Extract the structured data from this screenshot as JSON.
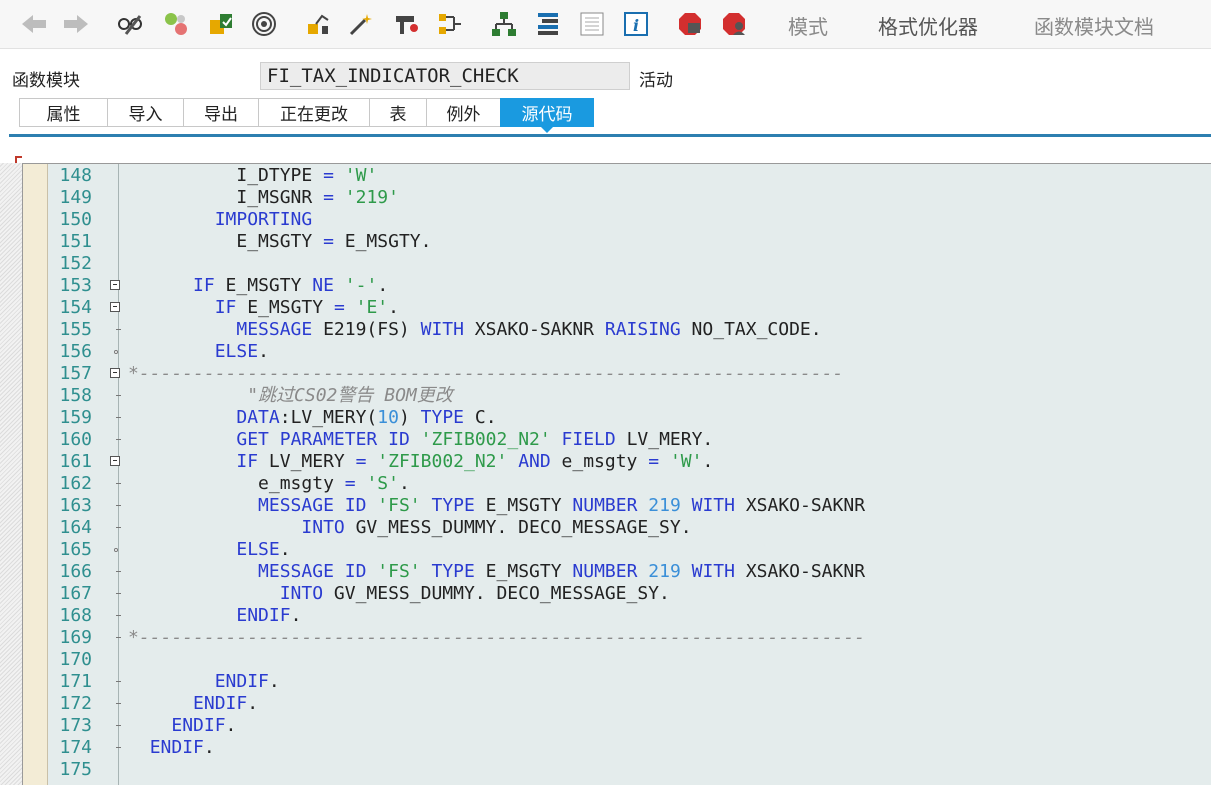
{
  "toolbar": {
    "icons": [
      "back-arrow-icon",
      "forward-arrow-icon",
      "glasses-pencil-icon",
      "toggle-active-icon",
      "check-object-icon",
      "activate-icon",
      "test-icon",
      "where-used-icon",
      "magic-wand-icon",
      "display-object-list-icon",
      "navigation-window-icon",
      "hierarchy-icon",
      "other-object-icon",
      "stack-icon",
      "info-icon",
      "stop-breakpoint-icon",
      "external-breakpoint-icon"
    ],
    "mode_label": "模式",
    "pretty_printer_label": "格式优化器",
    "fm_doc_label": "函数模块文档"
  },
  "header": {
    "label": "函数模块",
    "value": "FI_TAX_INDICATOR_CHECK",
    "status": "活动"
  },
  "tabs": [
    {
      "label": "属性"
    },
    {
      "label": "导入"
    },
    {
      "label": "导出"
    },
    {
      "label": "正在更改"
    },
    {
      "label": "表"
    },
    {
      "label": "例外"
    },
    {
      "label": "源代码",
      "active": true
    }
  ],
  "code_lines": [
    {
      "n": "148",
      "text": "          I_DTYPE = 'W'"
    },
    {
      "n": "149",
      "text": "          I_MSGNR = '219'"
    },
    {
      "n": "150",
      "text": "        IMPORTING"
    },
    {
      "n": "151",
      "text": "          E_MSGTY = E_MSGTY."
    },
    {
      "n": "152",
      "text": ""
    },
    {
      "n": "153",
      "text": "      IF E_MSGTY NE '-'."
    },
    {
      "n": "154",
      "text": "        IF E_MSGTY = 'E'."
    },
    {
      "n": "155",
      "text": "          MESSAGE E219(FS) WITH XSAKO-SAKNR RAISING NO_TAX_CODE."
    },
    {
      "n": "156",
      "text": "        ELSE."
    },
    {
      "n": "157",
      "text": "*-----------------------------------------------------------------"
    },
    {
      "n": "158",
      "text": "           \"跳过CS02警告 BOM更改"
    },
    {
      "n": "159",
      "text": "          DATA:LV_MERY(10) TYPE C."
    },
    {
      "n": "160",
      "text": "          GET PARAMETER ID 'ZFIB002_N2' FIELD LV_MERY."
    },
    {
      "n": "161",
      "text": "          IF LV_MERY = 'ZFIB002_N2' AND e_msgty = 'W'."
    },
    {
      "n": "162",
      "text": "            e_msgty = 'S'."
    },
    {
      "n": "163",
      "text": "            MESSAGE ID 'FS' TYPE E_MSGTY NUMBER 219 WITH XSAKO-SAKNR"
    },
    {
      "n": "164",
      "text": "                INTO GV_MESS_DUMMY. DECO_MESSAGE_SY."
    },
    {
      "n": "165",
      "text": "          ELSE."
    },
    {
      "n": "166",
      "text": "            MESSAGE ID 'FS' TYPE E_MSGTY NUMBER 219 WITH XSAKO-SAKNR"
    },
    {
      "n": "167",
      "text": "              INTO GV_MESS_DUMMY. DECO_MESSAGE_SY."
    },
    {
      "n": "168",
      "text": "          ENDIF."
    },
    {
      "n": "169",
      "text": "*-------------------------------------------------------------------"
    },
    {
      "n": "170",
      "text": ""
    },
    {
      "n": "171",
      "text": "        ENDIF."
    },
    {
      "n": "172",
      "text": "      ENDIF."
    },
    {
      "n": "173",
      "text": "    ENDIF."
    },
    {
      "n": "174",
      "text": "  ENDIF."
    },
    {
      "n": "175",
      "text": ""
    }
  ],
  "colors": {
    "keyword": "#2a3bd0",
    "string": "#2e9a4a",
    "number": "#3a8fd8",
    "line_number": "#2f8f8f",
    "active_tab": "#1a9ae0",
    "editor_bg": "#e4ecec"
  }
}
